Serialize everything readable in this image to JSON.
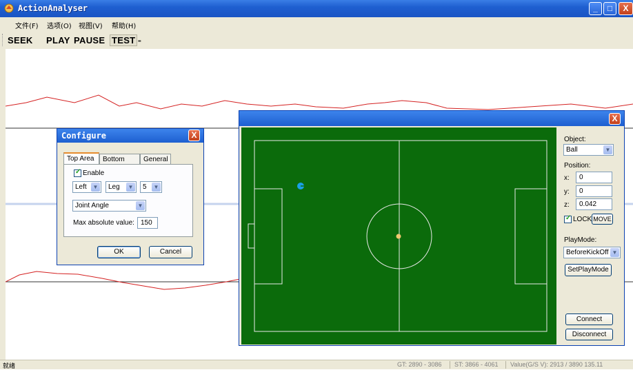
{
  "app": {
    "title": "ActionAnalyser"
  },
  "window_controls": {
    "minimize": "_",
    "maximize": "□",
    "close": "X"
  },
  "menu": [
    "文件(F)",
    "选项(O)",
    "视图(V)",
    "帮助(H)"
  ],
  "toolbar": {
    "seek": "SEEK",
    "play": "PLAY",
    "pause": "PAUSE",
    "test": "TEST",
    "overflow": "⁼"
  },
  "configure": {
    "title": "Configure",
    "close": "X",
    "tabs": [
      "Top Area",
      "Bottom Area",
      "General"
    ],
    "enable_label": "Enable",
    "side": "Left",
    "limb": "Leg",
    "index": "5",
    "measure": "Joint Angle",
    "max_label": "Max absolute value:",
    "max_value": "150",
    "ok": "OK",
    "cancel": "Cancel"
  },
  "field_window": {
    "close": "X",
    "object_label": "Object:",
    "object_value": "Ball",
    "position_label": "Position:",
    "x_label": "x:",
    "x_value": "0",
    "y_label": "y:",
    "y_value": "0",
    "z_label": "z:",
    "z_value": "0.042",
    "lock_label": "LOCK",
    "move_label": "MOVE",
    "playmode_label": "PlayMode:",
    "playmode_value": "BeforeKickOff",
    "setplaymode": "SetPlayMode",
    "connect": "Connect",
    "disconnect": "Disconnect"
  },
  "status": {
    "main": "就绪",
    "gt": "GT: 2890 - 3086",
    "st": "ST: 3866 - 4061",
    "value": "Value(G/S V): 2913 / 3890 135.11"
  },
  "colors": {
    "pitch": "#0b6b0b",
    "plot_line": "#d42020",
    "ball": "#1aa0e6",
    "titlebar": "#1f5fd0"
  }
}
